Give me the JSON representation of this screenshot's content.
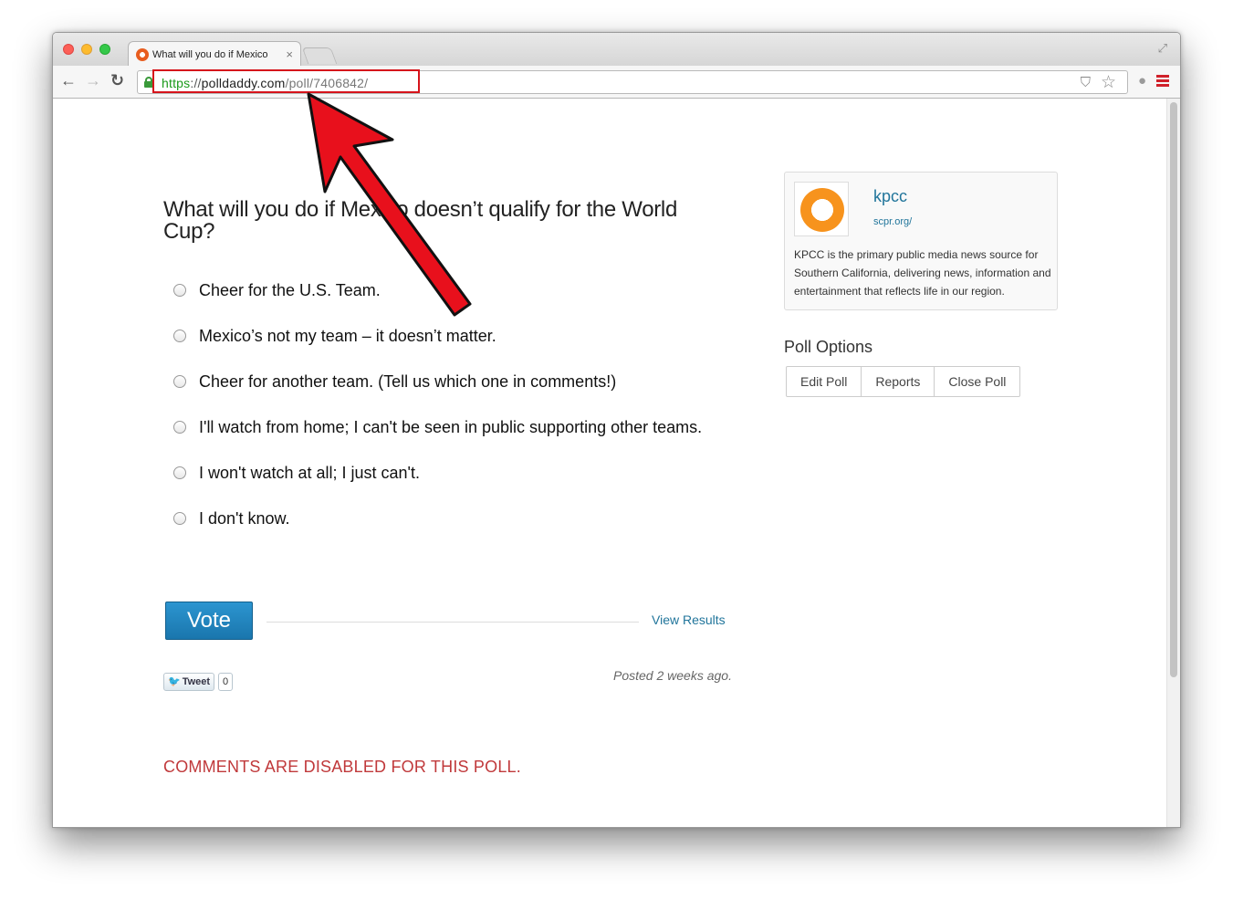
{
  "browser": {
    "tab_title": "What will you do if Mexico",
    "tab_close": "×",
    "url_scheme": "https",
    "url_sep": "://",
    "url_host": "polldaddy.com",
    "url_path": "/poll/7406842/"
  },
  "poll": {
    "question": "What will you do if Mexico doesn’t qualify for the World Cup?",
    "answers": [
      "Cheer for the U.S. Team.",
      "Mexico’s not my team – it doesn’t matter.",
      "Cheer for another team. (Tell us which one in comments!)",
      "I'll watch from home; I can't be seen in public supporting other teams.",
      "I won't watch at all; I just can't.",
      "I don't know."
    ],
    "vote_label": "Vote",
    "view_results_label": "View Results",
    "tweet_label": "Tweet",
    "tweet_count": "0",
    "posted": "Posted 2 weeks ago.",
    "comments_disabled": "COMMENTS ARE DISABLED FOR THIS POLL."
  },
  "sidebar": {
    "name": "kpcc",
    "url": "scpr.org/",
    "description": "KPCC is the primary public media news source for Southern California, delivering news, information and entertainment that reflects life in our region.",
    "poll_options_title": "Poll Options",
    "options": [
      "Edit Poll",
      "Reports",
      "Close Poll"
    ]
  },
  "colors": {
    "accent": "#21759b",
    "vote_button": "#1a76ad",
    "comments_disabled": "#c0393b",
    "annotation": "#e8101c",
    "kpcc_orange": "#f7931d"
  },
  "icons": [
    "back-icon",
    "forward-icon",
    "reload-icon",
    "lock-icon",
    "shield-icon",
    "star-icon",
    "extension-icon",
    "menu-icon",
    "twitter-bird-icon",
    "radio-icon"
  ]
}
